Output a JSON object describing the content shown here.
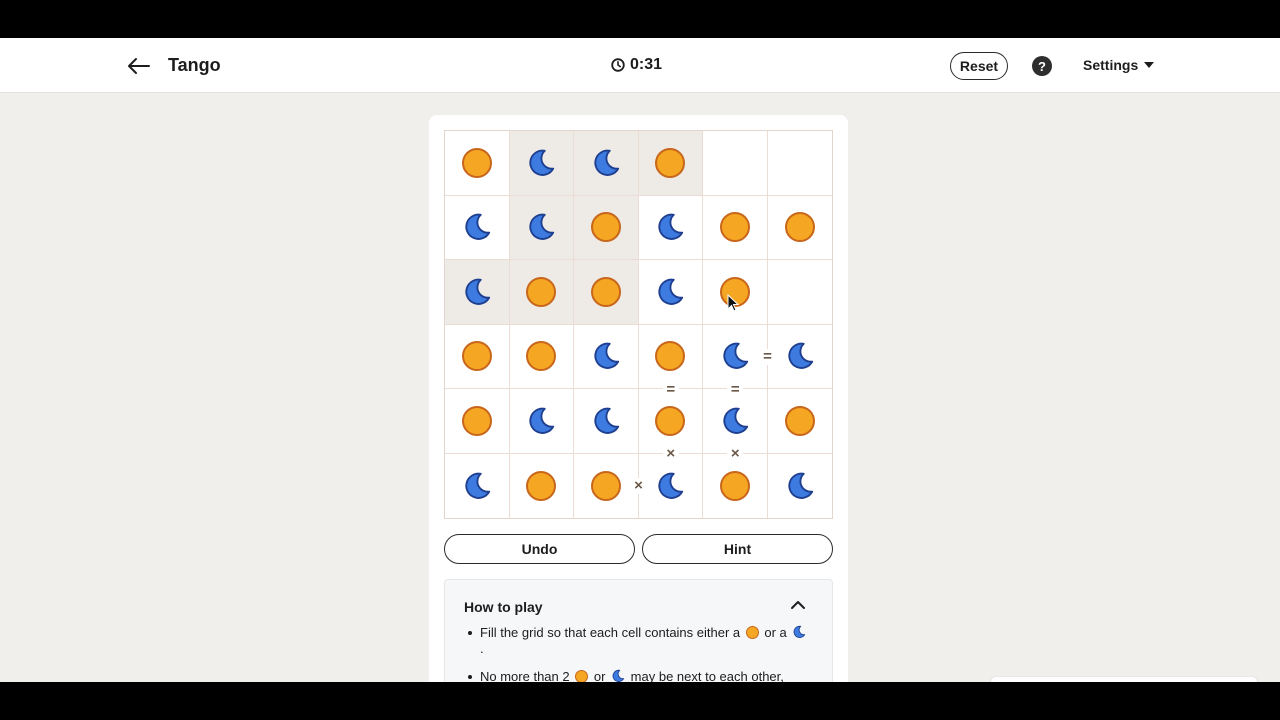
{
  "header": {
    "title": "Tango",
    "timer": "0:31",
    "reset_label": "Reset",
    "help_label": "?",
    "settings_label": "Settings"
  },
  "icons": {
    "back": "arrow-left-icon",
    "timer": "clock-icon",
    "help": "question-circle-icon",
    "settings": "caret-down-icon",
    "collapse": "chevron-up-icon"
  },
  "board": {
    "size": 6,
    "rows": [
      [
        "sun",
        "moon",
        "moon",
        "sun",
        "",
        ""
      ],
      [
        "moon",
        "moon",
        "sun",
        "moon",
        "sun",
        "sun"
      ],
      [
        "moon",
        "sun",
        "sun",
        "moon",
        "sun",
        ""
      ],
      [
        "sun",
        "sun",
        "moon",
        "sun",
        "moon",
        "moon"
      ],
      [
        "sun",
        "moon",
        "moon",
        "sun",
        "moon",
        "sun"
      ],
      [
        "moon",
        "sun",
        "sun",
        "moon",
        "sun",
        "moon"
      ]
    ],
    "locked": [
      [
        0,
        1
      ],
      [
        0,
        2
      ],
      [
        0,
        3
      ],
      [
        1,
        1
      ],
      [
        1,
        2
      ],
      [
        2,
        0
      ],
      [
        2,
        1
      ],
      [
        2,
        2
      ]
    ],
    "constraints": [
      {
        "type": "=",
        "between": [
          [
            3,
            4
          ],
          [
            3,
            5
          ]
        ]
      },
      {
        "type": "=",
        "between": [
          [
            3,
            3
          ],
          [
            4,
            3
          ]
        ]
      },
      {
        "type": "=",
        "between": [
          [
            3,
            4
          ],
          [
            4,
            4
          ]
        ]
      },
      {
        "type": "×",
        "between": [
          [
            4,
            3
          ],
          [
            5,
            3
          ]
        ]
      },
      {
        "type": "×",
        "between": [
          [
            4,
            4
          ],
          [
            5,
            4
          ]
        ]
      },
      {
        "type": "×",
        "between": [
          [
            5,
            2
          ],
          [
            5,
            3
          ]
        ]
      }
    ]
  },
  "colors": {
    "sun_fill": "#f5a623",
    "sun_stroke": "#c8661b",
    "moon_fill": "#3d7be0",
    "moon_stroke": "#1e3f8f",
    "locked_cell": "#eeeae6"
  },
  "controls": {
    "undo_label": "Undo",
    "hint_label": "Hint"
  },
  "how_to_play": {
    "title": "How to play",
    "rule1_text": "Fill the grid so that each cell contains either a",
    "rule1_or": "or a",
    "rule1_end": ".",
    "rule2_text": "No more than 2",
    "rule2_or": "or",
    "rule2_end": "may be next to each other,"
  }
}
